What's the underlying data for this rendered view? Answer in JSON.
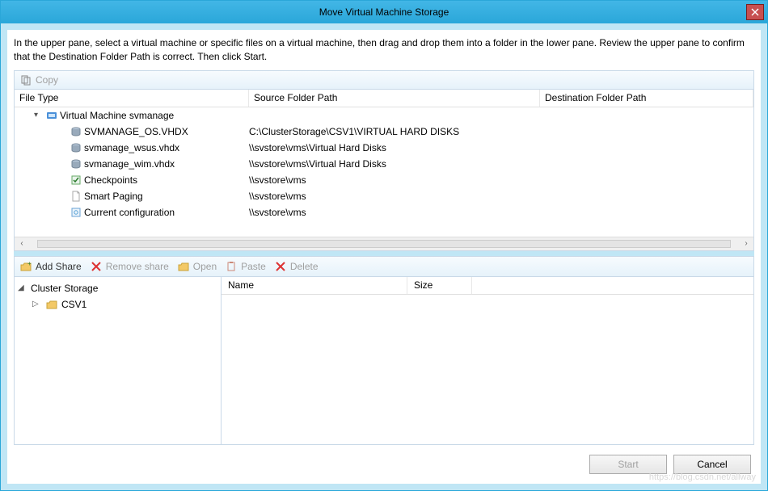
{
  "window": {
    "title": "Move Virtual Machine Storage"
  },
  "instructions": "In the upper pane, select a virtual machine or specific files on a virtual machine, then drag and drop them into a folder in the lower pane.  Review the upper pane to confirm that the Destination Folder Path is correct. Then click Start.",
  "upper_toolbar": {
    "copy": "Copy"
  },
  "columns": {
    "file_type": "File Type",
    "source": "Source Folder Path",
    "destination": "Destination Folder Path"
  },
  "vm": {
    "label": "Virtual Machine svmanage",
    "items": [
      {
        "name": "SVMANAGE_OS.VHDX",
        "icon": "disk",
        "src": "C:\\ClusterStorage\\CSV1\\VIRTUAL HARD DISKS",
        "dst": ""
      },
      {
        "name": "svmanage_wsus.vhdx",
        "icon": "disk",
        "src": "\\\\svstore\\vms\\Virtual Hard Disks",
        "dst": ""
      },
      {
        "name": "svmanage_wim.vhdx",
        "icon": "disk",
        "src": "\\\\svstore\\vms\\Virtual Hard Disks",
        "dst": ""
      },
      {
        "name": "Checkpoints",
        "icon": "check",
        "src": "\\\\svstore\\vms",
        "dst": ""
      },
      {
        "name": "Smart Paging",
        "icon": "page",
        "src": "\\\\svstore\\vms",
        "dst": ""
      },
      {
        "name": "Current configuration",
        "icon": "gear",
        "src": "\\\\svstore\\vms",
        "dst": ""
      }
    ]
  },
  "lower_toolbar": {
    "add_share": "Add Share",
    "remove_share": "Remove share",
    "open": "Open",
    "paste": "Paste",
    "delete": "Delete"
  },
  "tree": {
    "root": "Cluster Storage",
    "child": "CSV1"
  },
  "list_headers": {
    "name": "Name",
    "size": "Size"
  },
  "buttons": {
    "start": "Start",
    "cancel": "Cancel"
  },
  "watermark": "https://blog.csdn.net/allway"
}
